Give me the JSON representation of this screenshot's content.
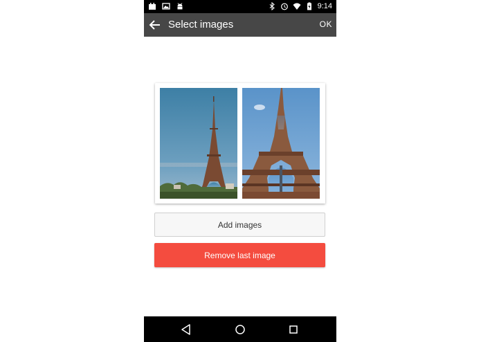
{
  "status_bar": {
    "time": "9:14",
    "left_icons": [
      "calendar-icon",
      "image-icon",
      "android-icon"
    ],
    "right_icons": [
      "bluetooth-icon",
      "alarm-icon",
      "wifi-icon",
      "battery-icon"
    ]
  },
  "toolbar": {
    "title": "Select images",
    "ok_label": "OK",
    "back_icon": "arrow-back-icon"
  },
  "gallery": {
    "images": [
      "eiffel-tower-far-photo",
      "eiffel-tower-close-photo"
    ]
  },
  "buttons": {
    "add_label": "Add images",
    "remove_label": "Remove last image"
  },
  "nav_bar": {
    "icons": [
      "back-triangle-icon",
      "home-circle-icon",
      "recents-square-icon"
    ]
  },
  "colors": {
    "toolbar_bg": "#474747",
    "remove_button_bg": "#f44c3f",
    "add_button_bg": "#f7f7f7"
  }
}
